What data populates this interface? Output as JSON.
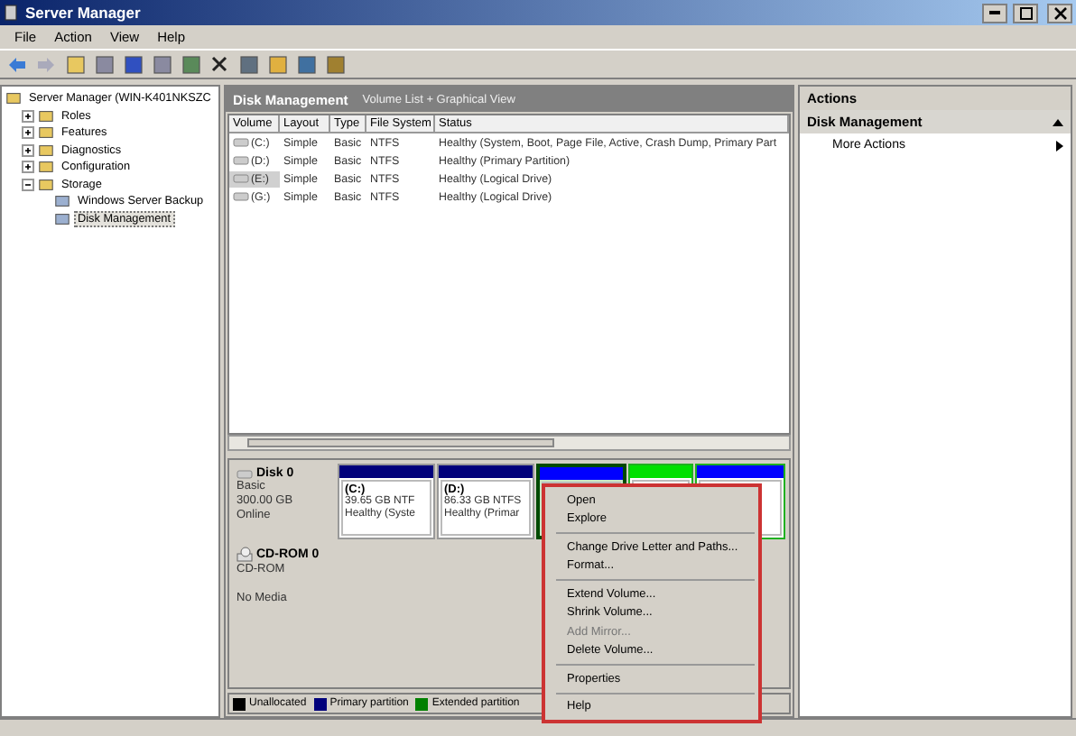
{
  "window": {
    "title": "Server Manager"
  },
  "menu_bar": [
    "File",
    "Action",
    "View",
    "Help"
  ],
  "tree": [
    {
      "label": "Server Manager (WIN-K401NKSZC",
      "selected": false,
      "children": [
        {
          "label": "Roles",
          "expanded": false,
          "selected": false
        },
        {
          "label": "Features",
          "expanded": false,
          "selected": false
        },
        {
          "label": "Diagnostics",
          "expanded": false,
          "selected": false
        },
        {
          "label": "Configuration",
          "expanded": false,
          "selected": false
        },
        {
          "label": "Storage",
          "expanded": true,
          "selected": false,
          "children": [
            {
              "label": "Windows Server Backup",
              "selected": false
            },
            {
              "label": "Disk Management",
              "selected": true
            }
          ]
        }
      ]
    }
  ],
  "center": {
    "title": "Disk Management",
    "subtitle": "Volume List + Graphical View",
    "table": {
      "columns": [
        "Volume",
        "Layout",
        "Type",
        "File System",
        "Status"
      ],
      "rows": [
        {
          "cells": [
            "(C:)",
            "Simple",
            "Basic",
            "NTFS",
            "Healthy (System, Boot, Page File, Active, Crash Dump, Primary Part"
          ],
          "selected": false
        },
        {
          "cells": [
            "(D:)",
            "Simple",
            "Basic",
            "NTFS",
            "Healthy (Primary Partition)"
          ],
          "selected": false
        },
        {
          "cells": [
            "(E:)",
            "Simple",
            "Basic",
            "NTFS",
            "Healthy (Logical Drive)"
          ],
          "selected": true
        },
        {
          "cells": [
            "(G:)",
            "Simple",
            "Basic",
            "NTFS",
            "Healthy (Logical Drive)"
          ],
          "selected": false
        }
      ]
    },
    "disks": [
      {
        "name": "Disk 0",
        "kind": "disk",
        "lines": [
          "Basic",
          "300.00 GB",
          "Online"
        ],
        "partitions": [
          {
            "label": "(C:)",
            "lines": [
              "39.65 GB NTF",
              "Healthy (Syste"
            ],
            "color": "#00007b",
            "extended": false,
            "selected": false
          },
          {
            "label": "(D:)",
            "lines": [
              "86.33 GB NTFS",
              "Healthy (Primar"
            ],
            "color": "#00007b",
            "extended": false,
            "selected": false
          },
          {
            "color": "#0000ff",
            "extended": true,
            "selected": true
          },
          {
            "color": "#00e000",
            "extended": true,
            "selected": false
          },
          {
            "color": "#0000ff",
            "extended": true,
            "selected": false
          }
        ]
      },
      {
        "name": "CD-ROM 0",
        "kind": "cdrom",
        "lines": [
          "CD-ROM",
          "No Media"
        ]
      }
    ],
    "legend": [
      {
        "label": "Unallocated",
        "color": "#000000"
      },
      {
        "label": "Primary partition",
        "color": "#00007b"
      },
      {
        "label": "Extended partition",
        "color": "#008000"
      }
    ]
  },
  "actions": {
    "title": "Actions",
    "section": "Disk Management",
    "items": [
      "More Actions"
    ]
  },
  "context_menu": [
    [
      {
        "label": "Open",
        "disabled": false
      },
      {
        "label": "Explore",
        "disabled": false
      }
    ],
    [
      {
        "label": "Change Drive Letter and Paths...",
        "disabled": false
      },
      {
        "label": "Format...",
        "disabled": false
      }
    ],
    [
      {
        "label": "Extend Volume...",
        "disabled": false
      },
      {
        "label": "Shrink Volume...",
        "disabled": false
      },
      {
        "label": "Add Mirror...",
        "disabled": true
      },
      {
        "label": "Delete Volume...",
        "disabled": false
      }
    ],
    [
      {
        "label": "Properties",
        "disabled": false
      }
    ],
    [
      {
        "label": "Help",
        "disabled": false
      }
    ]
  ]
}
